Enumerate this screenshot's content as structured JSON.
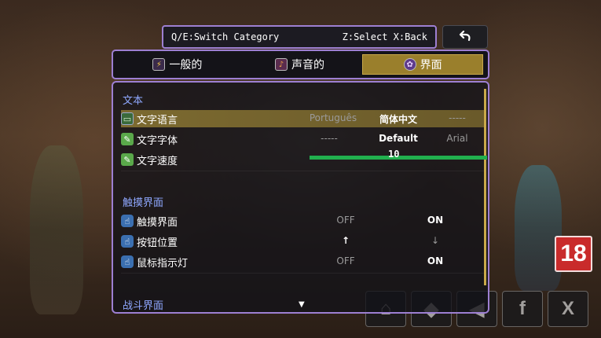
{
  "hint": {
    "text_left": "Q/E:Switch Category",
    "text_right": "Z:Select X:Back"
  },
  "tabs": [
    {
      "label": "一般的",
      "icon": "general-icon",
      "active": false
    },
    {
      "label": "声音的",
      "icon": "sound-icon",
      "active": false
    },
    {
      "label": "界面",
      "icon": "interface-icon",
      "active": true
    }
  ],
  "sections": {
    "text": {
      "title": "文本",
      "rows": {
        "language": {
          "label": "文字语言",
          "options": [
            "Português",
            "简体中文",
            "-----"
          ],
          "selected": "简体中文"
        },
        "font": {
          "label": "文字字体",
          "options": [
            "-----",
            "Default",
            "Arial"
          ],
          "selected": "Default"
        },
        "speed": {
          "label": "文字速度",
          "value": "10"
        }
      }
    },
    "touch": {
      "title": "触摸界面",
      "rows": {
        "touch_ui": {
          "label": "触摸界面",
          "options": [
            "OFF",
            "ON"
          ],
          "selected": "ON"
        },
        "button_pos": {
          "label": "按钮位置",
          "options": [
            "↑",
            "↓"
          ],
          "selected": "↓"
        },
        "cursor": {
          "label": "鼠标指示灯",
          "options": [
            "OFF",
            "ON"
          ],
          "selected": "ON"
        }
      }
    },
    "battle": {
      "title": "战斗界面"
    }
  },
  "overlay": {
    "age_rating": "18",
    "social": [
      "⌂",
      "◆",
      "◀",
      "f",
      "X"
    ]
  },
  "colors": {
    "frame": "#9d7fd2",
    "active_tab": "#9a7f2c",
    "section_title": "#8fa8ff",
    "slider": "#21b04e"
  }
}
